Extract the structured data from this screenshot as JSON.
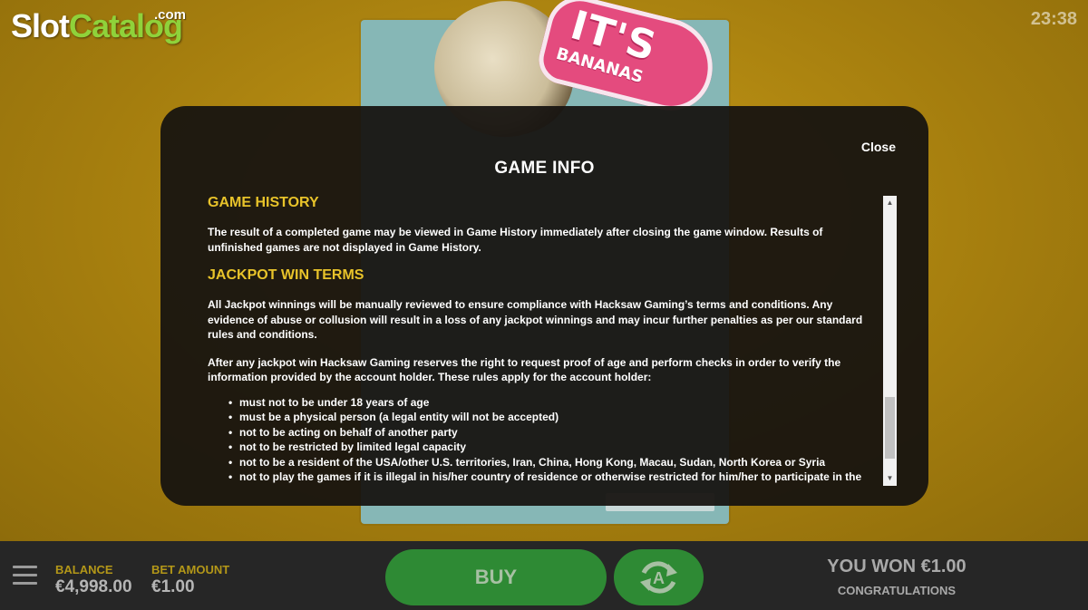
{
  "watermark": {
    "brand_a": "Slot",
    "brand_b": "Catalog",
    "suffix": ".com"
  },
  "clock": "23:38",
  "game_logo": {
    "line1": "IT'S",
    "line2": "BANANAS"
  },
  "modal": {
    "close_label": "Close",
    "title": "GAME INFO",
    "sections": {
      "history_heading": "GAME HISTORY",
      "history_text": "The result of a completed game may be viewed in Game History immediately after closing the game window. Results of unfinished games are not displayed in Game History.",
      "jackpot_heading": "JACKPOT WIN TERMS",
      "jackpot_text_1": "All Jackpot winnings will be manually reviewed to ensure compliance with Hacksaw Gaming’s terms and conditions. Any evidence of abuse or collusion will result in a loss of any jackpot winnings and may incur further penalties as per our standard rules and conditions.",
      "jackpot_text_2": "After any jackpot win Hacksaw Gaming reserves the right to request proof of age and perform checks in order to verify the information provided by the account holder. These rules apply for the account holder:",
      "rules": [
        "must not to be under 18 years of age",
        "must be a physical person (a legal entity will not be accepted)",
        "not to be acting on behalf of another party",
        "not to be restricted by limited legal capacity",
        "not to be a resident of the USA/other U.S. territories, Iran, China, Hong Kong, Macau, Sudan, North Korea or Syria",
        "not to play the games if it is illegal in his/her country of residence or otherwise restricted for him/her to participate in the"
      ]
    }
  },
  "bottom_bar": {
    "balance_label": "BALANCE",
    "balance_value": "€4,998.00",
    "bet_label": "BET AMOUNT",
    "bet_value": "€1.00",
    "buy_label": "BUY",
    "won_text": "YOU WON €1.00",
    "won_sub": "CONGRATULATIONS"
  },
  "colors": {
    "accent_yellow": "#e8c32a",
    "button_green": "#2e8a34",
    "bar_bg": "#262626"
  },
  "icons": [
    "menu-icon",
    "autoplay-icon",
    "scroll-up-icon",
    "scroll-down-icon"
  ]
}
